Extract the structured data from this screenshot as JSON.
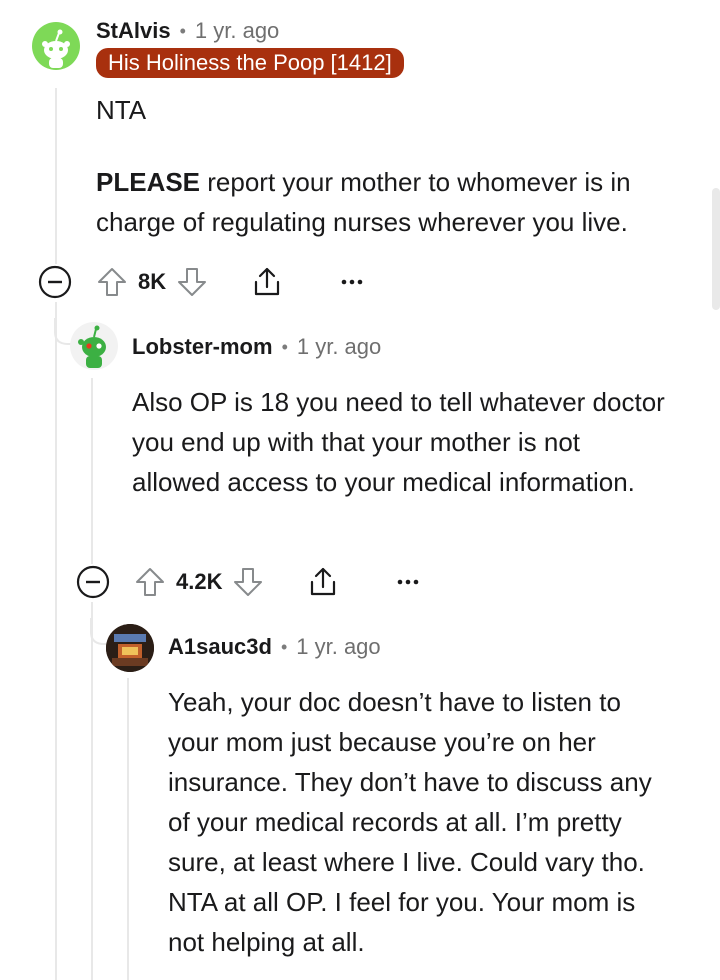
{
  "comments": [
    {
      "username": "StAlvis",
      "separator": "•",
      "time": "1 yr. ago",
      "flair": "His Holiness the Poop [1412]",
      "body_line1": "NTA",
      "body_bold": "PLEASE",
      "body_rest": " report your mother to whomever is in charge of regulating nurses wherever you live.",
      "votes": "8K",
      "avatar_color": "#7ed957"
    },
    {
      "username": "Lobster-mom",
      "separator": "•",
      "time": "1 yr. ago",
      "body": "Also OP is 18 you need to tell whatever doctor you end up with that your mother is not allowed access to your medical information.",
      "votes": "4.2K",
      "avatar_color": "#3cb043"
    },
    {
      "username": "A1sauc3d",
      "separator": "•",
      "time": "1 yr. ago",
      "body": "Yeah, your doc doesn’t have to listen to your mom just because you’re on her insurance. They don’t have to discuss any of your medical records at all. I’m pretty sure, at least where I live. Could vary tho. NTA at all OP. I feel for you. Your mom is not helping at all."
    }
  ],
  "icons": {
    "collapse": "minus-circle-icon",
    "upvote": "upvote-arrow-icon",
    "downvote": "downvote-arrow-icon",
    "share": "share-icon",
    "more": "more-options-icon"
  },
  "colors": {
    "flair_bg": "#a8300e",
    "thread_line": "#e8e8e8",
    "muted_text": "#6f6f6f"
  }
}
